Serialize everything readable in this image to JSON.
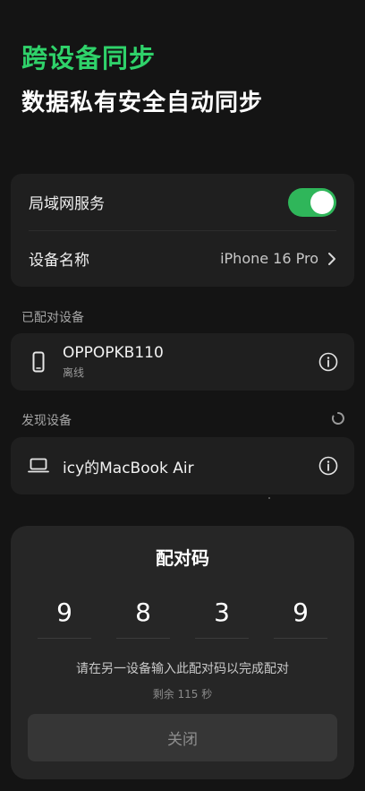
{
  "header": {
    "title": "跨设备同步",
    "subtitle": "数据私有安全自动同步"
  },
  "settings": {
    "lan_service_label": "局域网服务",
    "lan_service_enabled": true,
    "device_name_label": "设备名称",
    "device_name_value": "iPhone 16 Pro"
  },
  "paired": {
    "section_label": "已配对设备",
    "devices": [
      {
        "name": "OPPOPKB110",
        "status": "离线",
        "icon": "phone-icon"
      }
    ]
  },
  "discovered": {
    "section_label": "发现设备",
    "devices": [
      {
        "name": "icy的MacBook Air",
        "icon": "laptop-icon"
      }
    ]
  },
  "pairing_sheet": {
    "title": "配对码",
    "digits": [
      "9",
      "8",
      "3",
      "9"
    ],
    "hint": "请在另一设备输入此配对码以完成配对",
    "countdown": "剩余 115 秒",
    "close_label": "关闭"
  },
  "colors": {
    "accent_green": "#2fd26a",
    "toggle_on": "#2fb65a",
    "background": "#141414",
    "card": "#1f1f1f"
  }
}
